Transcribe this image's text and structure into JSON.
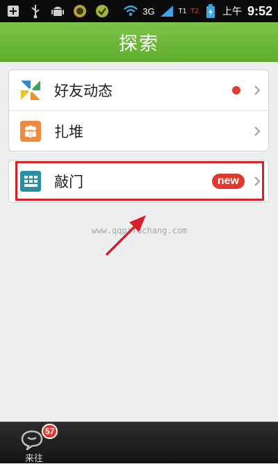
{
  "status_bar": {
    "network": "3G",
    "signal_label_1": "T1",
    "signal_label_2": "T2",
    "ampm": "上午",
    "time": "9:52",
    "left_icons": [
      "plus-box-icon",
      "usb-icon",
      "android-icon",
      "app-icon",
      "app-icon-2"
    ]
  },
  "header": {
    "title": "探索"
  },
  "menu": {
    "items": [
      {
        "label": "好友动态",
        "icon": "pinwheel-icon",
        "has_red_dot": true
      },
      {
        "label": "扎堆",
        "icon": "group-icon"
      },
      {
        "label": "敲门",
        "icon": "door-icon",
        "badge": "new",
        "highlighted": true
      }
    ]
  },
  "watermark": "www.qqpifuchang.com",
  "bottom_bar": {
    "tab_label": "来往",
    "badge_count": "57"
  },
  "colors": {
    "header_green": "#69b73a",
    "highlight_red": "#d72027",
    "badge_red": "#e2392d",
    "pinwheel_green": "#3aa660",
    "pinwheel_orange": "#f08e2a",
    "pinwheel_blue": "#2f8bd0",
    "group_orange": "#f08a3c",
    "door_teal": "#2b8fa3"
  }
}
